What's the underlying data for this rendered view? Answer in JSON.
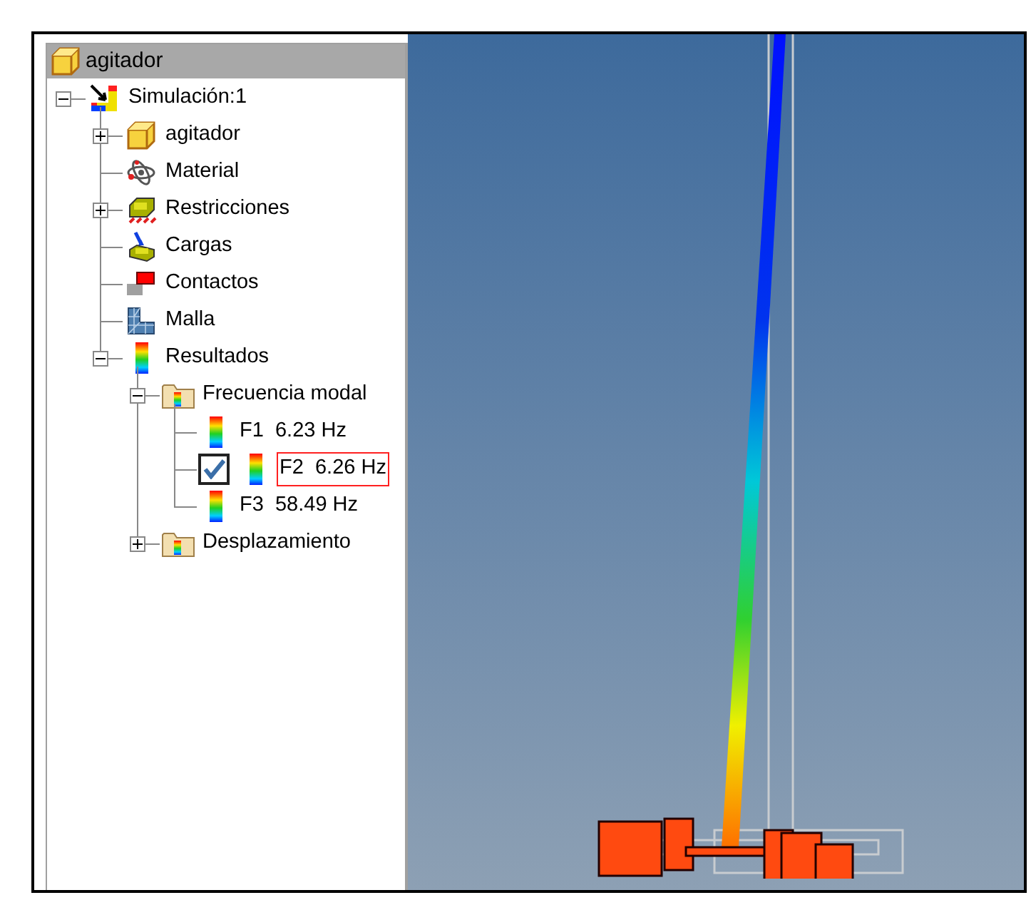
{
  "browser": {
    "title": "agitador",
    "kind": "part",
    "tree": [
      {
        "label": "Simulación:1",
        "kind": "simulation",
        "expanded": true,
        "children": [
          {
            "label": "agitador",
            "kind": "part",
            "expanded": false
          },
          {
            "label": "Material",
            "kind": "material"
          },
          {
            "label": "Restricciones",
            "kind": "constraints",
            "expanded": false
          },
          {
            "label": "Cargas",
            "kind": "loads"
          },
          {
            "label": "Contactos",
            "kind": "contacts"
          },
          {
            "label": "Malla",
            "kind": "mesh"
          },
          {
            "label": "Resultados",
            "kind": "results",
            "expanded": true,
            "children": [
              {
                "label": "Frecuencia modal",
                "kind": "folder",
                "expanded": true,
                "children": [
                  {
                    "label": "F1  6.23 Hz",
                    "kind": "results",
                    "checked": false,
                    "selected": false
                  },
                  {
                    "label": "F2  6.26 Hz",
                    "kind": "results",
                    "checked": true,
                    "selected": true
                  },
                  {
                    "label": "F3  58.49 Hz",
                    "kind": "results",
                    "checked": false,
                    "selected": false
                  }
                ]
              },
              {
                "label": "Desplazamiento",
                "kind": "folder",
                "expanded": false
              }
            ]
          }
        ]
      }
    ]
  }
}
